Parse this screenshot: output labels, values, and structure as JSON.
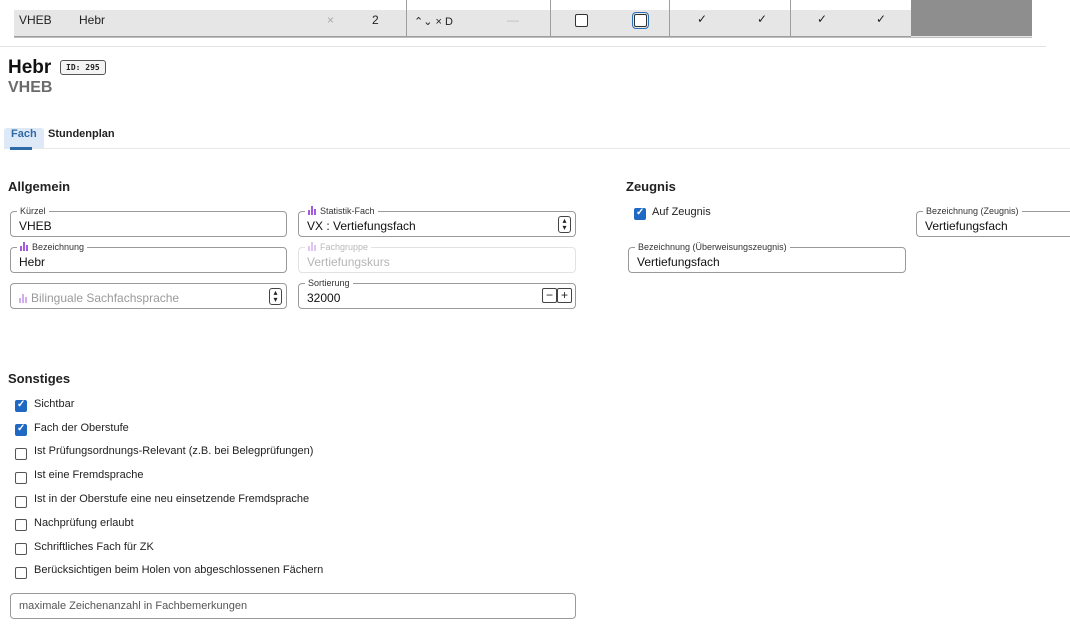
{
  "table_row": {
    "kuerzel": "VHEB",
    "bezeichnung": "Hebr",
    "clear_glyph": "×",
    "count": "2",
    "option_text": "⌃⌄ × D",
    "dash": "—",
    "ticks": [
      "✓",
      "✓",
      "✓",
      "✓"
    ]
  },
  "header": {
    "title": "Hebr",
    "id_badge": "ID: 295",
    "subtitle": "VHEB"
  },
  "tabs": [
    {
      "label": "Fach",
      "active": true
    },
    {
      "label": "Stundenplan",
      "active": false
    }
  ],
  "allgemein": {
    "heading": "Allgemein",
    "kuerzel": {
      "label": "Kürzel",
      "value": "VHEB"
    },
    "statistik_fach": {
      "label": "Statistik-Fach",
      "value": "VX : Vertiefungsfach",
      "icon": "statistics-bars-icon"
    },
    "bezeichnung": {
      "label": "Bezeichnung",
      "value": "Hebr",
      "icon": "statistics-bars-icon"
    },
    "fachgruppe": {
      "label": "Fachgruppe",
      "value": "Vertiefungskurs",
      "disabled": true
    },
    "bilinguale": {
      "placeholder": "Bilinguale Sachfachsprache",
      "icon": "statistics-bars-icon"
    },
    "sortierung": {
      "label": "Sortierung",
      "value": "32000",
      "minus": "−",
      "plus": "+"
    }
  },
  "zeugnis": {
    "heading": "Zeugnis",
    "auf_zeugnis": {
      "label": "Auf Zeugnis",
      "checked": true
    },
    "bezeichnung_zeugnis": {
      "label": "Bezeichnung (Zeugnis)",
      "value": "Vertiefungsfach"
    },
    "bezeichnung_ueberweisung": {
      "label": "Bezeichnung (Überweisungszeugnis)",
      "value": "Vertiefungsfach"
    }
  },
  "sonstiges": {
    "heading": "Sonstiges",
    "items": [
      {
        "label": "Sichtbar",
        "checked": true
      },
      {
        "label": "Fach der Oberstufe",
        "checked": true
      },
      {
        "label": "Ist Prüfungsordnungs-Relevant (z.B. bei Belegprüfungen)",
        "checked": false
      },
      {
        "label": "Ist eine Fremdsprache",
        "checked": false
      },
      {
        "label": "Ist in der Oberstufe eine neu einsetzende Fremdsprache",
        "checked": false
      },
      {
        "label": "Nachprüfung erlaubt",
        "checked": false
      },
      {
        "label": "Schriftliches Fach für ZK",
        "checked": false
      },
      {
        "label": "Berücksichtigen beim Holen von abgeschlossenen Fächern",
        "checked": false
      }
    ],
    "max_zeichen_placeholder": "maximale Zeichenanzahl in Fachbemerkungen"
  },
  "colors": {
    "accent": "#1f68c4",
    "icon_purple": "#a45be0",
    "grey_cell": "#8e8e8e"
  }
}
